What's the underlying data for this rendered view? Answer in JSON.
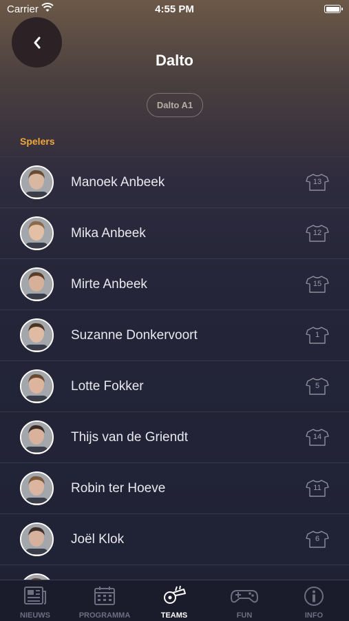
{
  "status_bar": {
    "carrier": "Carrier",
    "time": "4:55 PM"
  },
  "header": {
    "title": "Dalto",
    "team_chip": "Dalto A1"
  },
  "section_label": "Spelers",
  "players": [
    {
      "name": "Manoek Anbeek",
      "number": "13"
    },
    {
      "name": "Mika Anbeek",
      "number": "12"
    },
    {
      "name": "Mirte Anbeek",
      "number": "15"
    },
    {
      "name": "Suzanne Donkervoort",
      "number": "1"
    },
    {
      "name": "Lotte Fokker",
      "number": "5"
    },
    {
      "name": "Thijs van de Griendt",
      "number": "14"
    },
    {
      "name": "Robin ter Hoeve",
      "number": "11"
    },
    {
      "name": "Joël Klok",
      "number": "6"
    },
    {
      "name": "",
      "number": ""
    }
  ],
  "tabs": [
    {
      "label": "NIEUWS",
      "icon": "newspaper-icon"
    },
    {
      "label": "PROGRAMMA",
      "icon": "calendar-icon"
    },
    {
      "label": "TEAMS",
      "icon": "whistle-icon",
      "active": true
    },
    {
      "label": "FUN",
      "icon": "gamepad-icon"
    },
    {
      "label": "INFO",
      "icon": "info-icon"
    }
  ],
  "colors": {
    "accent": "#f0a83a",
    "background": "#1f2134",
    "tab_active": "#ffffff",
    "tab_inactive": "#6e6f80"
  }
}
